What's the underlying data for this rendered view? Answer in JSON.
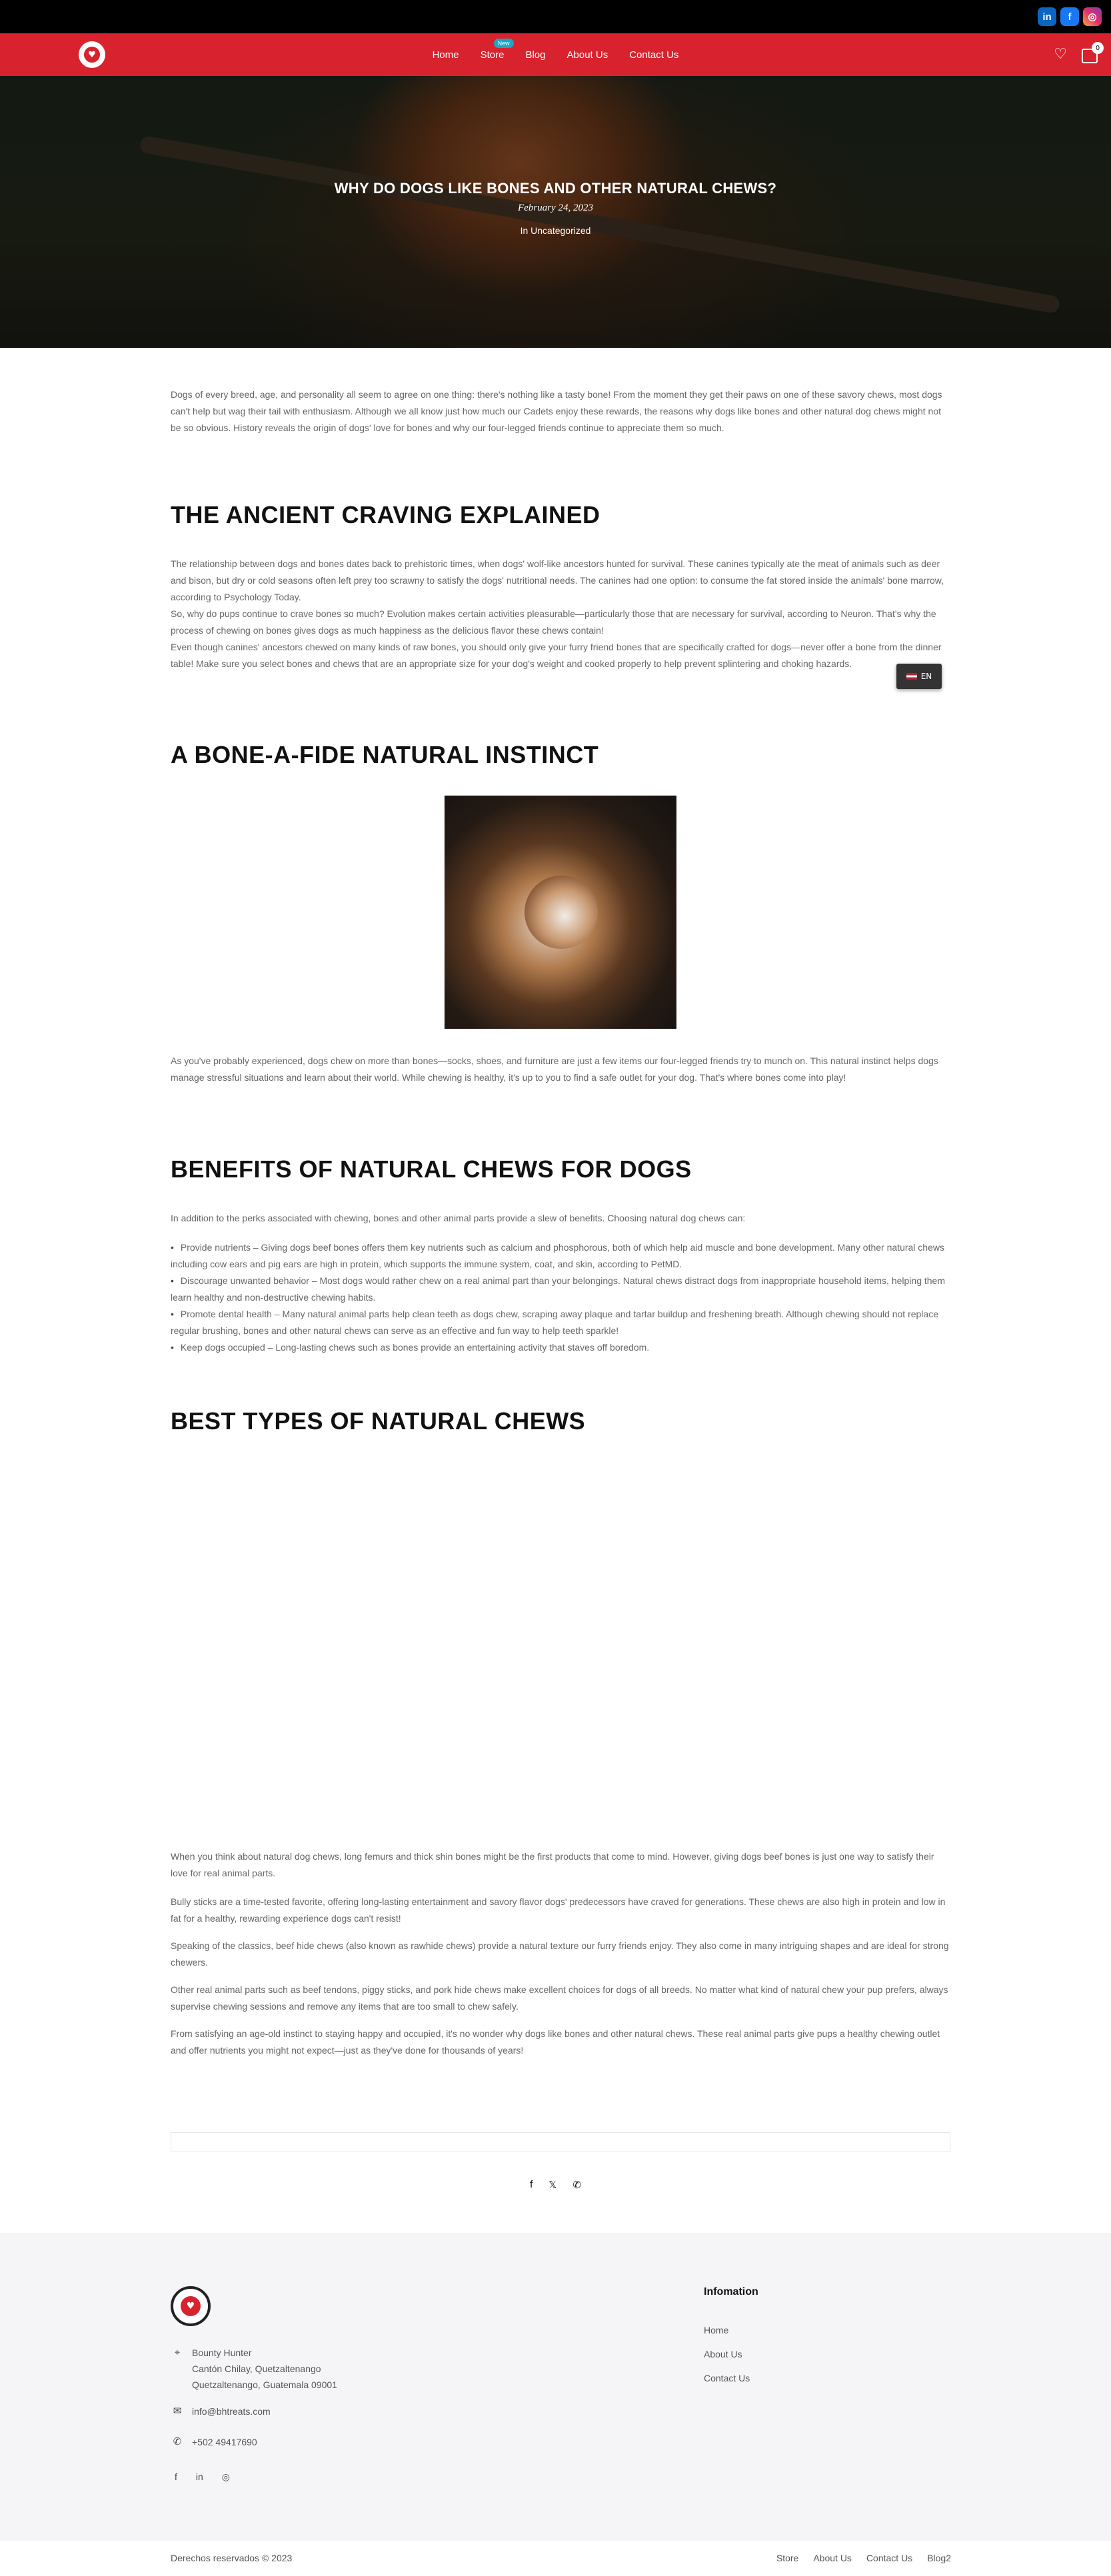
{
  "nav": {
    "items": [
      {
        "label": "Home"
      },
      {
        "label": "Store",
        "badge": "New"
      },
      {
        "label": "Blog"
      },
      {
        "label": "About Us"
      },
      {
        "label": "Contact Us"
      }
    ],
    "cart_count": "0",
    "social_top": [
      "in",
      "f",
      "◎"
    ]
  },
  "hero": {
    "title": "WHY DO DOGS LIKE BONES AND OTHER NATURAL CHEWS?",
    "date": "February 24, 2023",
    "category": "In Uncategorized"
  },
  "article": {
    "intro": "Dogs of every breed, age, and personality all seem to agree on one thing: there's nothing like a tasty bone! From the moment they get their paws on one of these savory chews, most dogs can't help but wag their tail with enthusiasm. Although we all know just how much our Cadets enjoy these rewards, the reasons why dogs like bones and other natural dog chews might not be so obvious. History reveals the origin of dogs' love for bones and why our four-legged friends continue to appreciate them so much.",
    "h_ancient": "THE ANCIENT CRAVING EXPLAINED",
    "ancient_p1": "The relationship between dogs and bones dates back to prehistoric times, when dogs' wolf-like ancestors hunted for survival. These canines typically ate the meat of animals such as deer and bison, but dry or cold seasons often left prey too scrawny to satisfy the dogs' nutritional needs. The canines had one option: to consume the fat stored inside the animals' bone marrow, according to Psychology Today.",
    "ancient_p2": "So, why do pups continue to crave bones so much? Evolution makes certain activities pleasurable—particularly those that are necessary for survival, according to Neuron. That's why the process of chewing on bones gives dogs as much happiness as the delicious flavor these chews contain!",
    "ancient_p3": "Even though canines' ancestors chewed on many kinds of raw bones, you should only give your furry friend bones that are specifically crafted for dogs—never offer a bone from the dinner table! Make sure you select bones and chews that are an appropriate size for your dog's weight and cooked properly to help prevent splintering and choking hazards.",
    "h_instinct": "A BONE-A-FIDE NATURAL INSTINCT",
    "instinct_p": "As you've probably experienced, dogs chew on more than bones—socks, shoes, and furniture are just a few items our four-legged friends try to munch on. This natural instinct helps dogs manage stressful situations and learn about their world. While chewing is healthy, it's up to you to find a safe outlet for your dog. That's where bones come into play!",
    "h_benefits": "BENEFITS OF NATURAL CHEWS FOR DOGS",
    "benefits_intro": "In addition to the perks associated with chewing, bones and other animal parts provide a slew of benefits. Choosing natural dog chews can:",
    "benefits": [
      "Provide nutrients – Giving dogs beef bones offers them key nutrients such as calcium and phosphorous, both of which help aid muscle and bone development. Many other natural chews including cow ears and pig ears are high in protein, which supports the immune system, coat, and skin, according to PetMD.",
      "Discourage unwanted behavior – Most dogs would rather chew on a real animal part than your belongings. Natural chews distract dogs from inappropriate household items, helping them learn healthy and non-destructive chewing habits.",
      "Promote dental health – Many natural animal parts help clean teeth as dogs chew, scraping away plaque and tartar buildup and freshening breath. Although chewing should not replace regular brushing, bones and other natural chews can serve as an effective and fun way to help teeth sparkle!",
      "Keep dogs occupied – Long-lasting chews such as bones provide an entertaining activity that staves off boredom."
    ],
    "h_types": "BEST TYPES OF NATURAL CHEWS",
    "types_p1": "When you think about natural dog chews, long femurs and thick shin bones might be the first products that come to mind. However, giving dogs beef bones is just one way to satisfy their love for real animal parts.",
    "types_p2": "Bully sticks are a time-tested favorite, offering long-lasting entertainment and savory flavor dogs' predecessors have craved for generations. These chews are also high in protein and low in fat for a healthy, rewarding experience dogs can't resist!",
    "types_p3": "Speaking of the classics, beef hide chews (also known as rawhide chews) provide a natural texture our furry friends enjoy. They also come in many intriguing shapes and are ideal for strong chewers.",
    "types_p4": "Other real animal parts such as beef tendons, piggy sticks, and pork hide chews make excellent choices for dogs of all breeds. No matter what kind of natural chew your pup prefers, always supervise chewing sessions and remove any items that are too small to chew safely.",
    "types_p5": "From satisfying an age-old instinct to staying happy and occupied, it's no wonder why dogs like bones and other natural chews. These real animal parts give pups a healthy chewing outlet and offer nutrients you might not expect—just as they've done for thousands of years!"
  },
  "lang_switcher": {
    "label": "EN"
  },
  "share": {
    "icons": [
      "f",
      "𝕏",
      "✆"
    ]
  },
  "footer": {
    "logo_text": "BOUNTY HUNTER",
    "address_lines": [
      "Bounty Hunter",
      "Cantón Chilay, Quetzaltenango",
      "Quetzaltenango, Guatemala 09001"
    ],
    "email": "info@bhtreats.com",
    "phone": "+502 49417690",
    "social": [
      "f",
      "in",
      "◎"
    ],
    "info_title": "Infomation",
    "info_links": [
      "Home",
      "About Us",
      "Contact Us"
    ],
    "copyright": "Derechos reservados © 2023",
    "bottom_links": [
      "Store",
      "About Us",
      "Contact Us",
      "Blog2"
    ]
  },
  "colors": {
    "brand_red": "#d8232f",
    "badge_blue": "#19a7c5",
    "footer_bg": "#f5f5f7"
  }
}
